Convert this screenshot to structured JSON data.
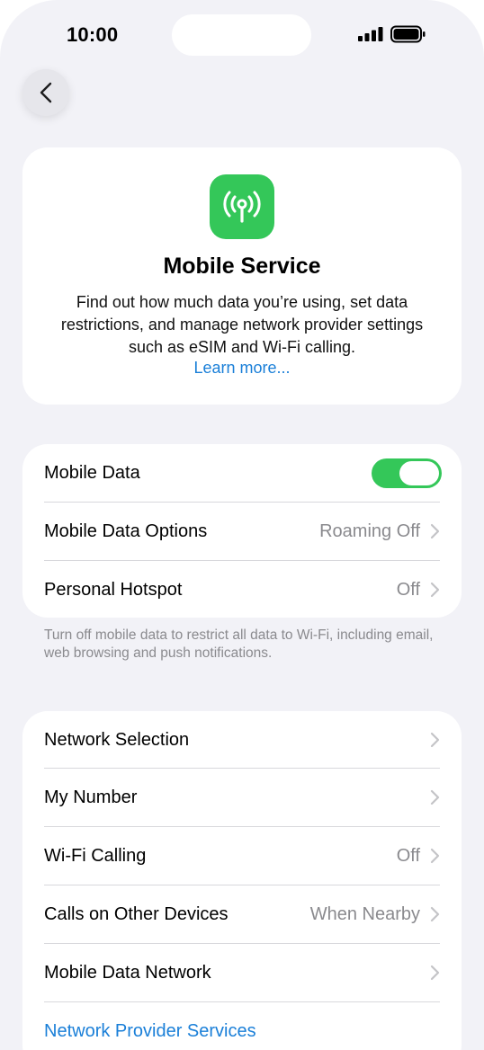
{
  "status_bar": {
    "time": "10:00"
  },
  "hero": {
    "title": "Mobile Service",
    "description": "Find out how much data you’re using, set data restrictions, and manage network provider settings such as eSIM and Wi-Fi calling.",
    "learn_more": "Learn more..."
  },
  "data_group": {
    "mobile_data": {
      "label": "Mobile Data",
      "enabled": true
    },
    "data_options": {
      "label": "Mobile Data Options",
      "value": "Roaming Off"
    },
    "hotspot": {
      "label": "Personal Hotspot",
      "value": "Off"
    },
    "footnote": "Turn off mobile data to restrict all data to Wi-Fi, including email, web browsing and push notifications."
  },
  "network_group": {
    "network_selection": {
      "label": "Network Selection"
    },
    "my_number": {
      "label": "My Number"
    },
    "wifi_calling": {
      "label": "Wi-Fi Calling",
      "value": "Off"
    },
    "other_devices": {
      "label": "Calls on Other Devices",
      "value": "When Nearby"
    },
    "data_network": {
      "label": "Mobile Data Network"
    },
    "provider_services": {
      "label": "Network Provider Services"
    }
  },
  "colors": {
    "accent": "#1a7fd8",
    "toggle_on": "#34c759",
    "background": "#f2f2f7"
  }
}
